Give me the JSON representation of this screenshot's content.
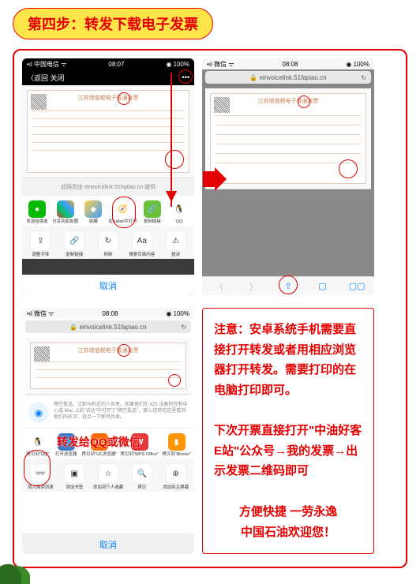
{
  "step_title": "第四步：转发下载电子发票",
  "phone1": {
    "carrier": "•ıl 中国电信 ᯤ",
    "time": "08:07",
    "battery": "◉ 100%",
    "back": "〈返回",
    "close": "关闭",
    "more": "•••",
    "share_info": "此网页由 einvoicelink.51faplao.cn 提供",
    "row1": [
      {
        "icon": "💬",
        "color": "#09bb07",
        "label": "发送给朋友"
      },
      {
        "icon": "✿",
        "color": "#e4393c,#07c160,#409eff,#faad14",
        "label": "分享到朋友圈",
        "multi": true
      },
      {
        "icon": "⬢",
        "color": "#409eff",
        "label": "收藏"
      },
      {
        "icon": "🧭",
        "color": "#007aff",
        "label": "在Safari中打开"
      },
      {
        "icon": "📋",
        "color": "#67c23a",
        "label": "复制链接"
      },
      {
        "icon": "🐧",
        "color": "#000",
        "label": "QQ"
      }
    ],
    "row2": [
      {
        "icon": "⇪",
        "label": "调整字体"
      },
      {
        "icon": "🔗",
        "label": "复制链接"
      },
      {
        "icon": "↻",
        "label": "刷新"
      },
      {
        "icon": "Aa",
        "label": "搜索页面内容"
      },
      {
        "icon": "⚠",
        "label": "投诉"
      }
    ],
    "cancel": "取消",
    "invoice_title": "江苏增值税电子普通发票"
  },
  "phone2": {
    "carrier": "•ıl 微信 ᯤ",
    "time": "08:08",
    "battery": "◉ 100%",
    "url": "🔒 einvoicelink.51fapiao.cn",
    "reload": "↻",
    "toolbar": [
      "〈",
      "〉",
      "⇧",
      "▢",
      "▢▢"
    ],
    "invoice_title": "江苏增值税电子普通发票"
  },
  "phone3": {
    "carrier": "•ıl 微信 ᯤ",
    "time": "08:08",
    "battery": "◉ 100%",
    "url": "🔒 einvoicelink.51fapiao.cn",
    "reload": "↻",
    "airdrop": "隔空投送。立即与附近的人共享。如果他们在 iOS 设备的控制中心或 Mac 上的\"访达\"中打开了\"隔空投送\"，那么您将在这里看到他们的名字。轻点一下即可共享。",
    "overlay": "转发给QQ或微信",
    "row1": [
      {
        "icon": "🐧",
        "color": "#e4393c,#fff",
        "label": "拷贝到\"QQ\"",
        "qq": true
      },
      {
        "icon": "🌐",
        "color": "#409eff",
        "label": "打开浏览器"
      },
      {
        "icon": "UC",
        "color": "#ff6a00",
        "label": "拷贝到\"UC浏览器\""
      },
      {
        "icon": "W",
        "color": "#e4393c",
        "label": "拷贝到\"WPS Office\""
      },
      {
        "icon": "▮",
        "color": "#ff9500",
        "label": "拷贝到\"iBooks\""
      }
    ],
    "row2": [
      {
        "icon": "◉",
        "label": "加入阅读列表"
      },
      {
        "icon": "▣",
        "label": "添加书签"
      },
      {
        "icon": "☆",
        "label": "添加到个人收藏"
      },
      {
        "icon": "🔍",
        "label": "拷贝"
      },
      {
        "icon": "⊕",
        "label": "添加到主屏幕"
      }
    ],
    "cancel": "取消",
    "invoice_title": "江苏增值税电子普通发票"
  },
  "note": {
    "p1": "注意：安卓系统手机需要直接打开转发或者用相应浏览器打开转发。需要打印的在电脑打印即可。",
    "p2": "下次开票直接打开\"中油好客E站\"公众号→我的发票→出示发票二维码即可",
    "p3a": "方便快捷 一劳永逸",
    "p3b": "中国石油欢迎您！"
  }
}
